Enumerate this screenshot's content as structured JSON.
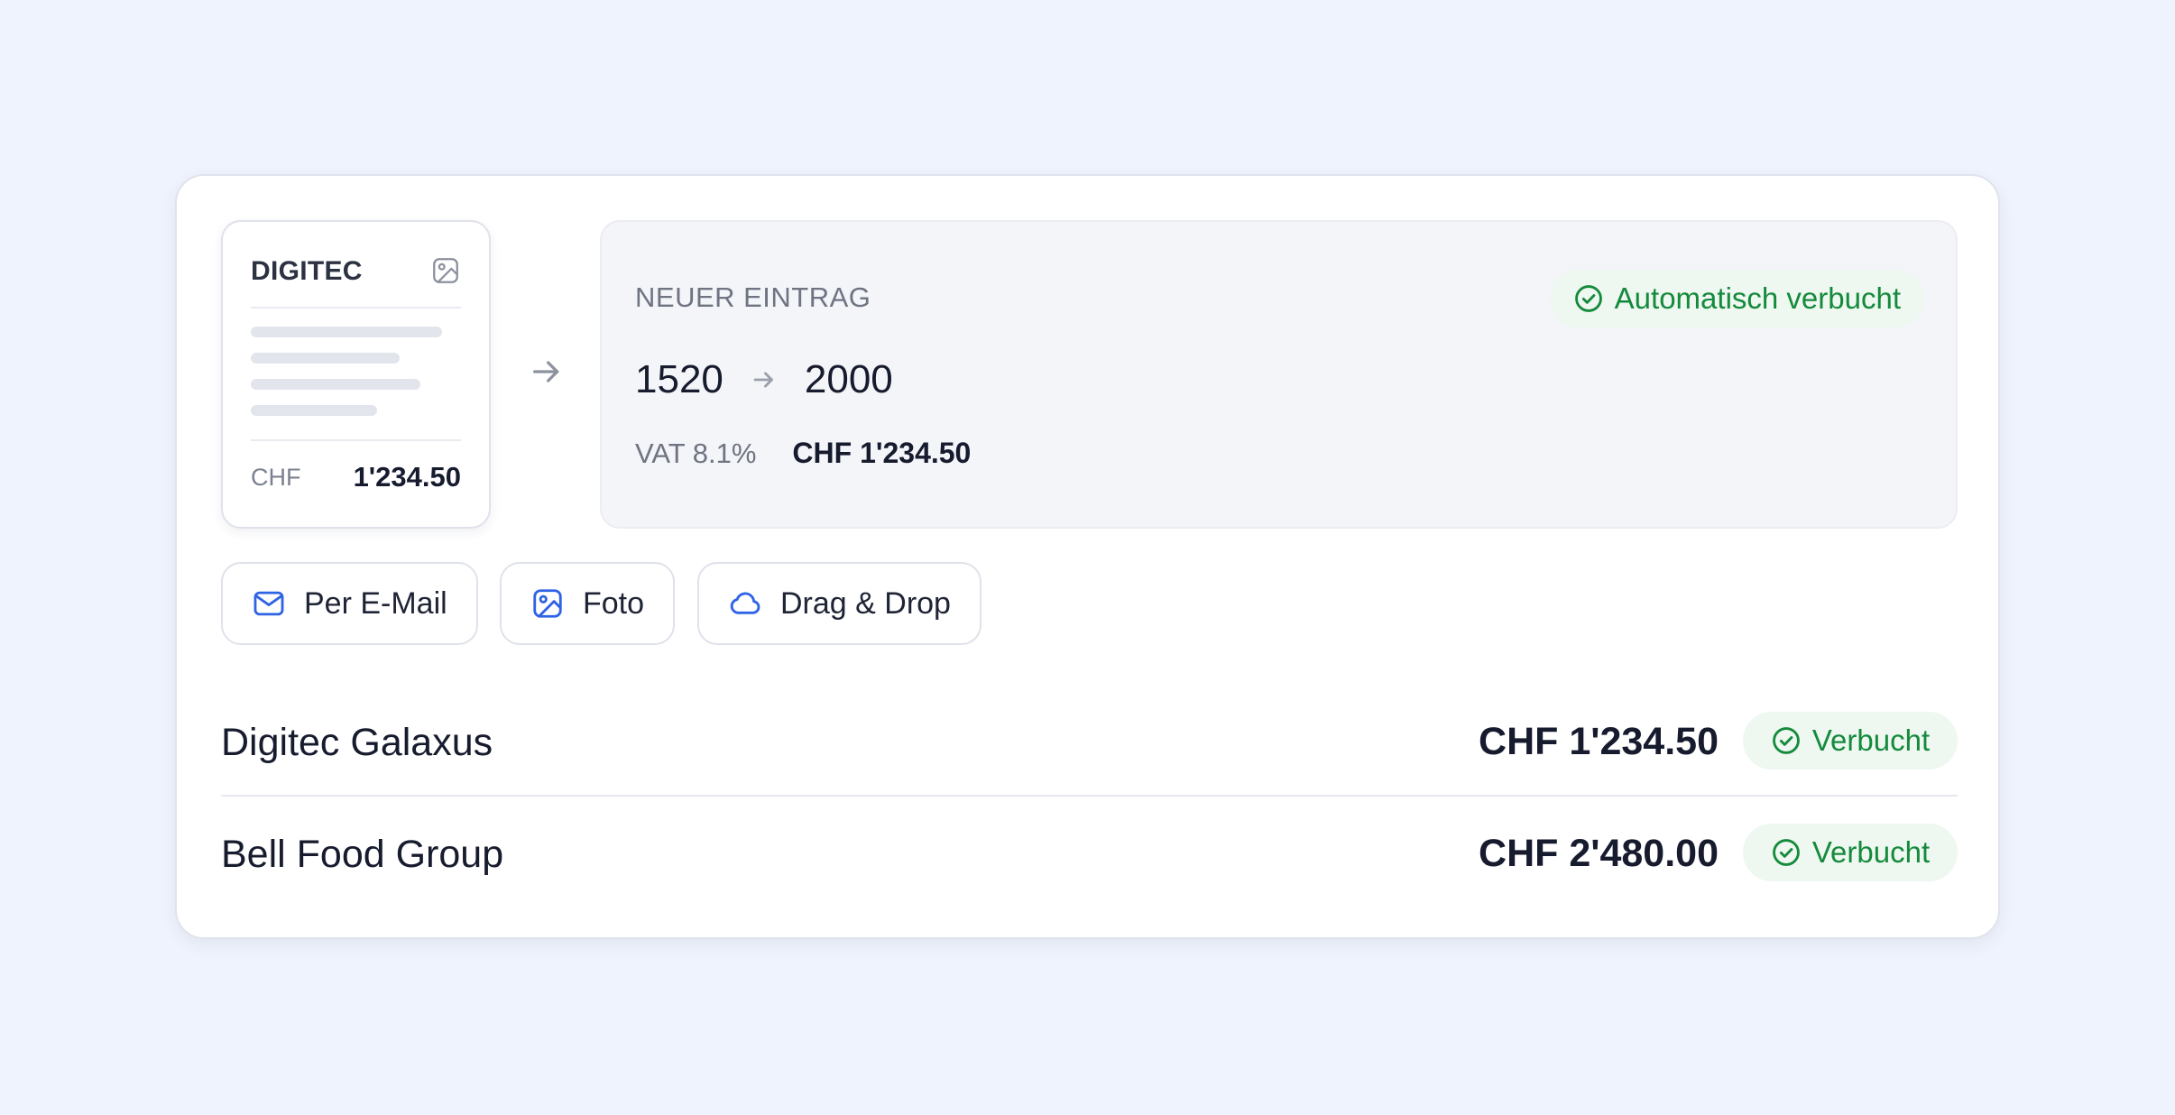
{
  "receipt": {
    "vendor": "DIGITEC",
    "currency": "CHF",
    "amount": "1'234.50",
    "image_icon": "image-icon"
  },
  "entry": {
    "label": "NEUER EINTRAG",
    "status": "Automatisch verbucht",
    "debit_account": "1520",
    "credit_account": "2000",
    "vat_label": "VAT 8.1%",
    "vat_amount": "CHF 1'234.50"
  },
  "upload_options": [
    {
      "label": "Per E-Mail",
      "icon": "mail-icon"
    },
    {
      "label": "Foto",
      "icon": "image-icon"
    },
    {
      "label": "Drag & Drop",
      "icon": "cloud-icon"
    }
  ],
  "transactions": [
    {
      "name": "Digitec Galaxus",
      "amount": "CHF 1'234.50",
      "status": "Verbucht"
    },
    {
      "name": "Bell Food Group",
      "amount": "CHF 2'480.00",
      "status": "Verbucht"
    }
  ],
  "colors": {
    "background": "#eff3fd",
    "accent_blue": "#2f63e6",
    "success_green": "#148a3c",
    "success_bg": "#eef7f0"
  }
}
